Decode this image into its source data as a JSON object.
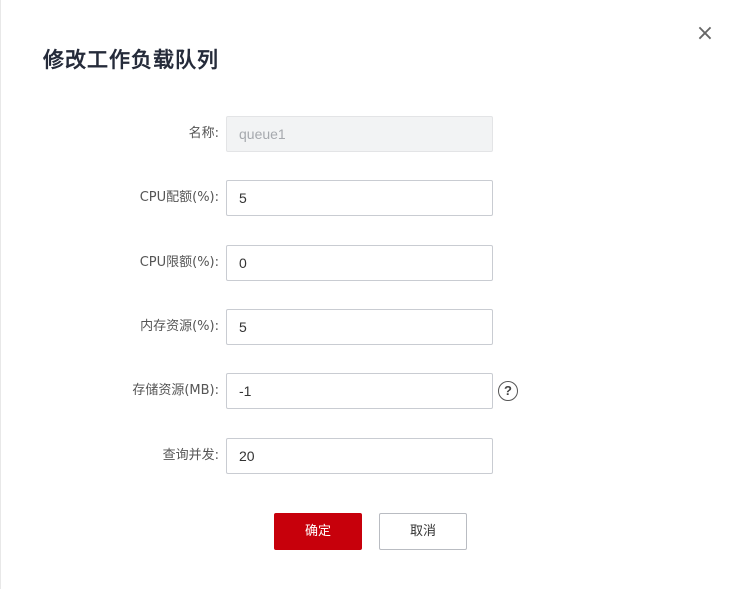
{
  "dialog": {
    "title": "修改工作负载队列",
    "close_glyph": "×",
    "close_icon": "close-icon"
  },
  "fields": [
    {
      "label": "名称:",
      "value": "queue1",
      "disabled": true
    },
    {
      "label": "CPU配额(%):",
      "value": "5",
      "disabled": false
    },
    {
      "label": "CPU限额(%):",
      "value": "0",
      "disabled": false
    },
    {
      "label": "内存资源(%):",
      "value": "5",
      "disabled": false
    },
    {
      "label": "存储资源(MB):",
      "value": "-1",
      "disabled": false,
      "help_icon": "question-circle-icon",
      "help_glyph": "?"
    },
    {
      "label": "查询并发:",
      "value": "20",
      "disabled": false
    }
  ],
  "buttons": {
    "confirm": "确定",
    "cancel": "取消"
  },
  "colors": {
    "primary": "#c7000b",
    "disabled_bg": "#f2f3f4"
  }
}
